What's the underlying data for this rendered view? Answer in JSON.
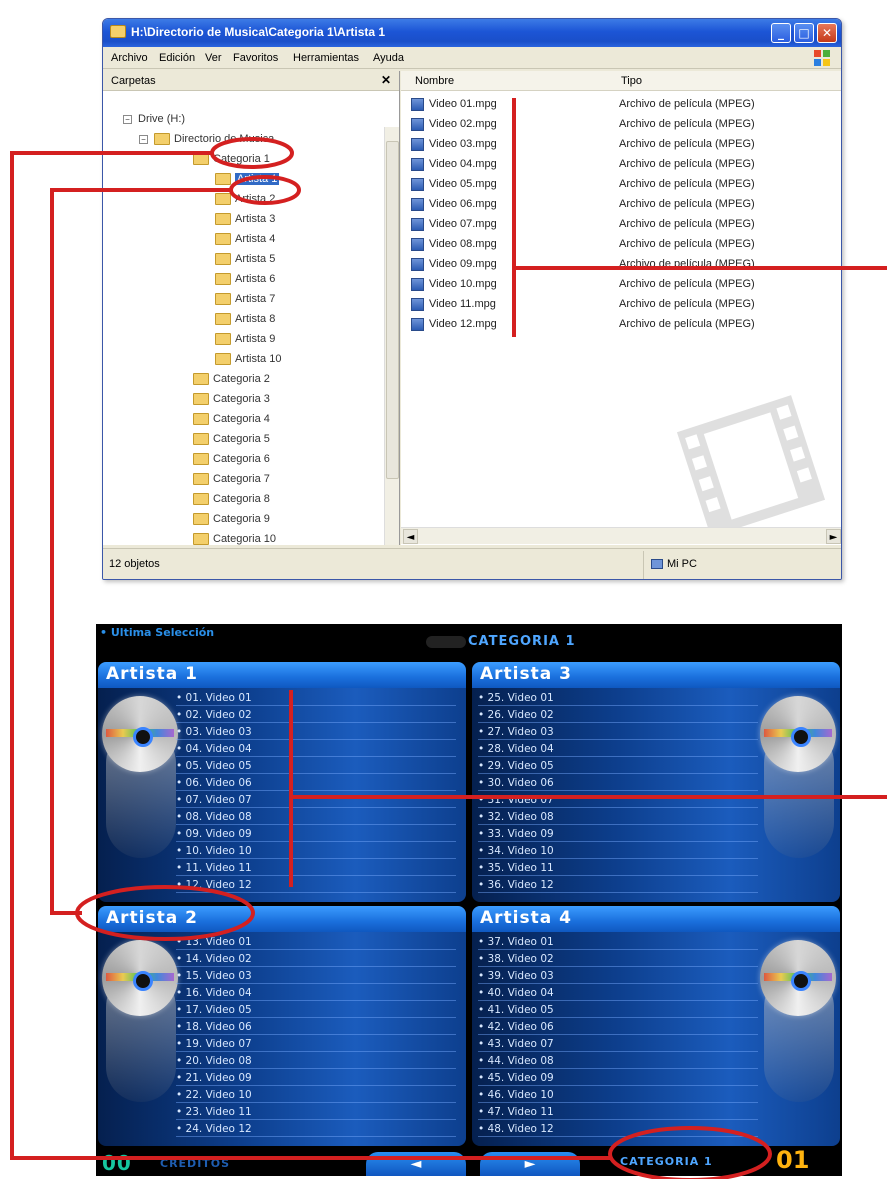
{
  "explorer": {
    "title": "H:\\Directorio de Musica\\Categoria 1\\Artista 1",
    "menu": [
      "Archivo",
      "Edición",
      "Ver",
      "Favoritos",
      "Herramientas",
      "Ayuda"
    ],
    "folders_header": "Carpetas",
    "tree": {
      "drive": "Drive (H:)",
      "root": "Directorio de Musica",
      "category_open": "Categoria 1",
      "artists": [
        "Artista 1",
        "Artista 2",
        "Artista 3",
        "Artista 4",
        "Artista 5",
        "Artista 6",
        "Artista 7",
        "Artista 8",
        "Artista 9",
        "Artista 10"
      ],
      "categories": [
        "Categoria 2",
        "Categoria 3",
        "Categoria 4",
        "Categoria 5",
        "Categoria 6",
        "Categoria 7",
        "Categoria 8",
        "Categoria 9",
        "Categoria 10"
      ]
    },
    "columns": {
      "name": "Nombre",
      "type": "Tipo"
    },
    "files": [
      {
        "name": "Video 01.mpg",
        "type": "Archivo de película (MPEG)"
      },
      {
        "name": "Video 02.mpg",
        "type": "Archivo de película (MPEG)"
      },
      {
        "name": "Video 03.mpg",
        "type": "Archivo de película (MPEG)"
      },
      {
        "name": "Video 04.mpg",
        "type": "Archivo de película (MPEG)"
      },
      {
        "name": "Video 05.mpg",
        "type": "Archivo de película (MPEG)"
      },
      {
        "name": "Video 06.mpg",
        "type": "Archivo de película (MPEG)"
      },
      {
        "name": "Video 07.mpg",
        "type": "Archivo de película (MPEG)"
      },
      {
        "name": "Video 08.mpg",
        "type": "Archivo de película (MPEG)"
      },
      {
        "name": "Video 09.mpg",
        "type": "Archivo de película (MPEG)"
      },
      {
        "name": "Video 10.mpg",
        "type": "Archivo de película (MPEG)"
      },
      {
        "name": "Video 11.mpg",
        "type": "Archivo de película (MPEG)"
      },
      {
        "name": "Video 12.mpg",
        "type": "Archivo de película (MPEG)"
      }
    ],
    "status": {
      "count": "12 objetos",
      "location": "Mi PC"
    }
  },
  "menu": {
    "last_selection": "• Ultima Selección",
    "category_title": "CATEGORIA 1",
    "panels": [
      {
        "title": "Artista 1",
        "items": [
          "• 01. Video 01",
          "• 02. Video 02",
          "• 03. Video 03",
          "• 04. Video 04",
          "• 05. Video 05",
          "• 06. Video 06",
          "• 07. Video 07",
          "• 08. Video 08",
          "• 09. Video 09",
          "• 10. Video 10",
          "• 11. Video 11",
          "• 12. Video 12"
        ]
      },
      {
        "title": "Artista 3",
        "items": [
          "• 25. Video 01",
          "• 26. Video 02",
          "• 27. Video 03",
          "• 28. Video 04",
          "• 29. Video 05",
          "• 30. Video 06",
          "• 31. Video 07",
          "• 32. Video 08",
          "• 33. Video 09",
          "• 34. Video 10",
          "• 35. Video 11",
          "• 36. Video 12"
        ]
      },
      {
        "title": "Artista 2",
        "items": [
          "• 13. Video 01",
          "• 14. Video 02",
          "• 15. Video 03",
          "• 16. Video 04",
          "• 17. Video 05",
          "• 18. Video 06",
          "• 19. Video 07",
          "• 20. Video 08",
          "• 21. Video 09",
          "• 22. Video 10",
          "• 23. Video 11",
          "• 24. Video 12"
        ]
      },
      {
        "title": "Artista 4",
        "items": [
          "• 37. Video 01",
          "• 38. Video 02",
          "• 39. Video 03",
          "• 40. Video 04",
          "• 41. Video 05",
          "• 42. Video 06",
          "• 43. Video 07",
          "• 44. Video 08",
          "• 45. Video 09",
          "• 46. Video 10",
          "• 47. Video 11",
          "• 48. Video 12"
        ]
      }
    ],
    "credits_value": "00",
    "credits_label": "CREDITOS",
    "prev_symbol": "◄",
    "next_symbol": "►",
    "category_bottom": "CATEGORIA 1",
    "category_number": "01"
  },
  "colors": {
    "annotation": "#d42020",
    "title_blue": "#1c55d6",
    "panel_blue": "#1a6fdc"
  },
  "icons": [
    "folder-icon",
    "video-file-icon",
    "cd-disc-icon",
    "windows-logo-icon",
    "computer-icon",
    "film-strip-icon"
  ]
}
